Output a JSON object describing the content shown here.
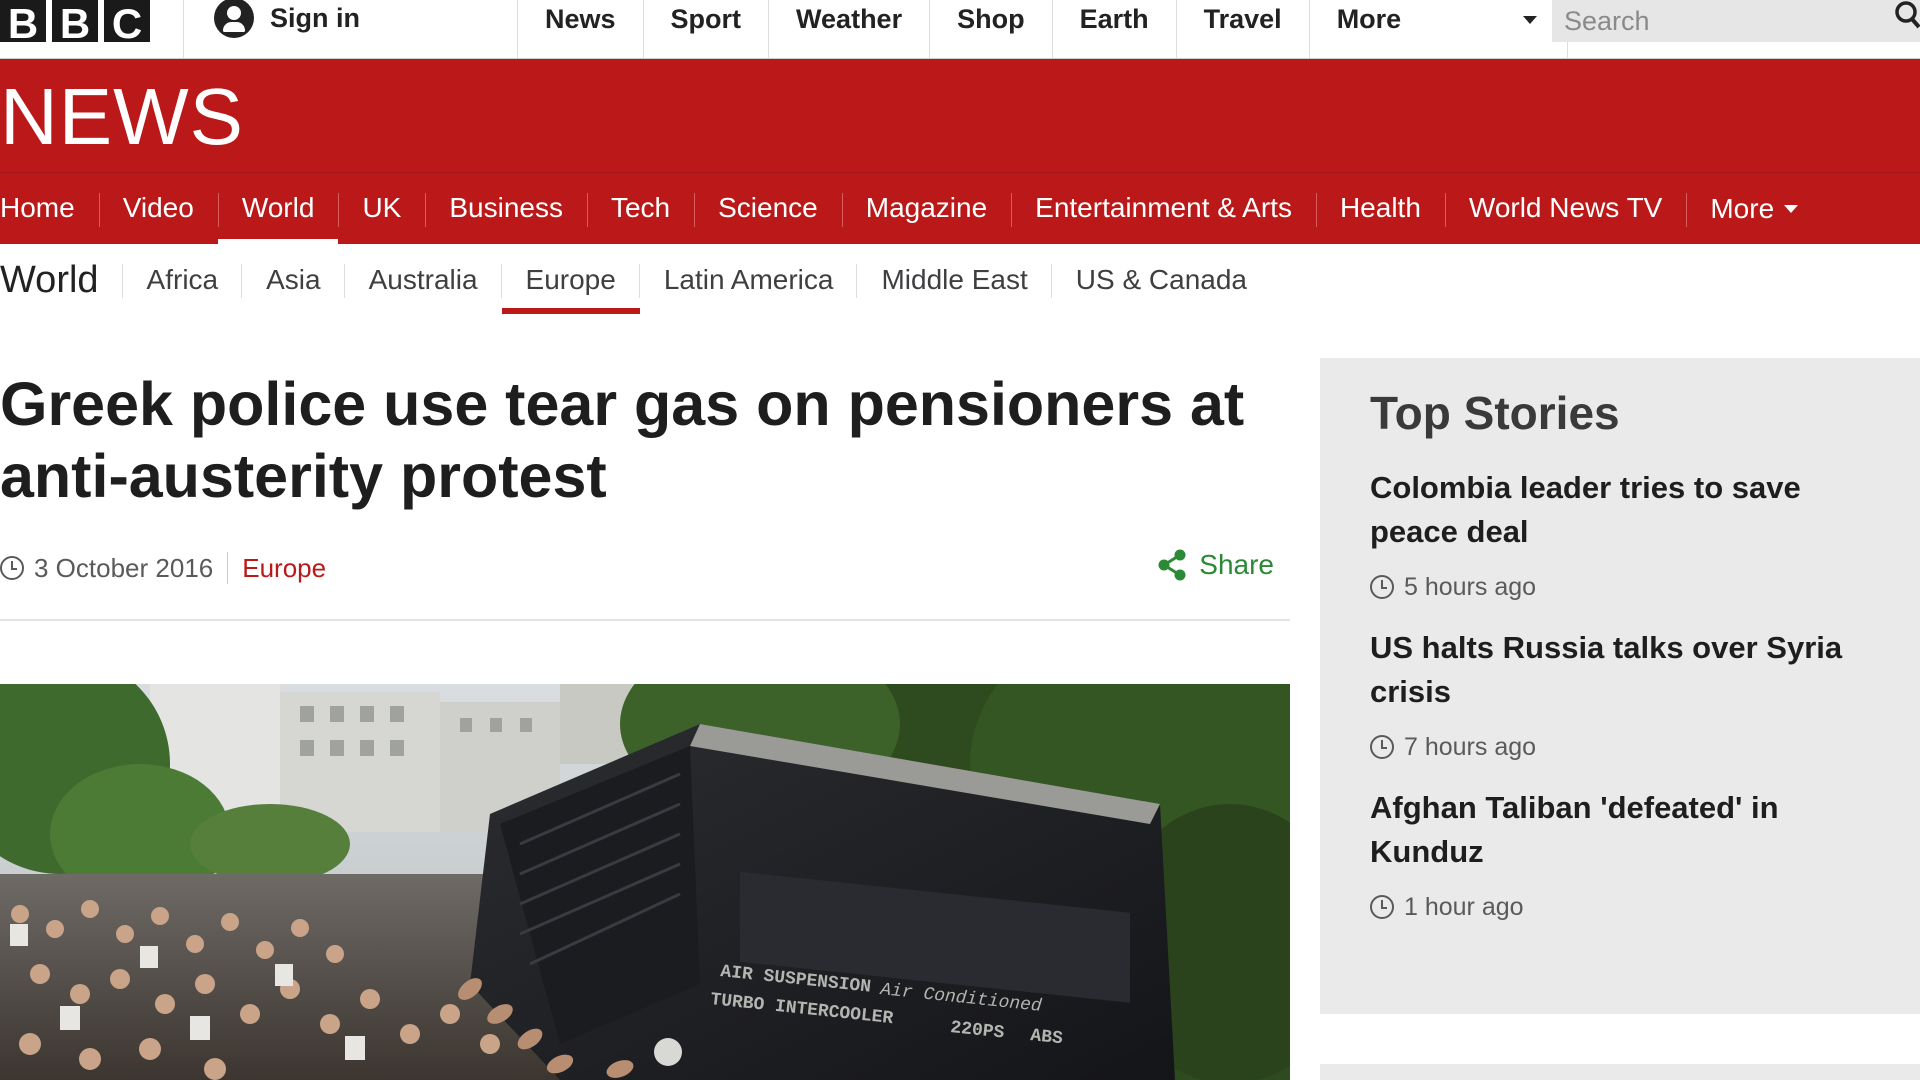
{
  "brand": {
    "letters": [
      "B",
      "B",
      "C"
    ],
    "news_wordmark": "NEWS",
    "colors": {
      "news_red": "#bb1919",
      "share_green": "#2a8a36"
    }
  },
  "topbar": {
    "sign_in": "Sign in",
    "nav": [
      "News",
      "Sport",
      "Weather",
      "Shop",
      "Earth",
      "Travel"
    ],
    "more": "More",
    "search_placeholder": "Search"
  },
  "main_nav": {
    "items": [
      "Home",
      "Video",
      "World",
      "UK",
      "Business",
      "Tech",
      "Science",
      "Magazine",
      "Entertainment & Arts",
      "Health",
      "World News TV"
    ],
    "more": "More",
    "active": "World"
  },
  "sub_nav": {
    "title": "World",
    "items": [
      "Africa",
      "Asia",
      "Australia",
      "Europe",
      "Latin America",
      "Middle East",
      "US & Canada"
    ],
    "active": "Europe"
  },
  "article": {
    "headline": "Greek police use tear gas on pensioners at anti-austerity protest",
    "date": "3 October 2016",
    "section": "Europe",
    "share": "Share",
    "image_text": [
      "AIR SUSPENSION",
      "Air Conditioned",
      "TURBO INTERCOOLER",
      "220PS",
      "ABS"
    ]
  },
  "top_stories": {
    "title": "Top Stories",
    "items": [
      {
        "headline": "Colombia leader tries to save peace deal",
        "time": "5 hours ago"
      },
      {
        "headline": "US halts Russia talks over Syria crisis",
        "time": "7 hours ago"
      },
      {
        "headline": "Afghan Taliban 'defeated' in Kunduz",
        "time": "1 hour ago"
      }
    ]
  }
}
